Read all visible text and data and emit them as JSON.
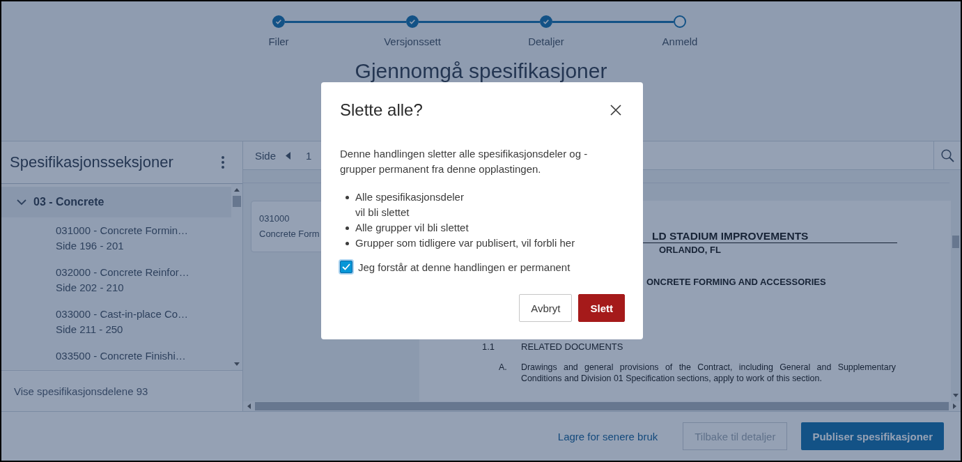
{
  "stepper": [
    {
      "label": "Filer",
      "done": true
    },
    {
      "label": "Versjonssett",
      "done": true
    },
    {
      "label": "Detaljer",
      "done": true
    },
    {
      "label": "Anmeld",
      "done": false
    }
  ],
  "page_title": "Gjennomgå spesifikasjoner",
  "sections_panel": {
    "title": "Spesifikasjonsseksjoner",
    "group": {
      "label": "03 - Concrete",
      "expanded": true,
      "children": [
        {
          "title": "031000 - Concrete Formin…",
          "pages": "Side 196 - 201"
        },
        {
          "title": "032000 - Concrete Reinfor…",
          "pages": "Side 202 - 210"
        },
        {
          "title": "033000 - Cast-in-place Co…",
          "pages": "Side 211 - 250"
        },
        {
          "title": "033500 - Concrete Finishi…"
        }
      ]
    },
    "footer": "Vise spesifikasjonsdelene 93"
  },
  "viewer": {
    "page_label": "Side",
    "page_number": "1",
    "card": {
      "code": "031000",
      "title": "Concrete Form"
    },
    "document": {
      "heading": "LD STADIUM IMPROVEMENTS",
      "location": "ORLANDO, FL",
      "section": "ONCRETE FORMING AND ACCESSORIES",
      "article_number": "1.1",
      "article": "RELATED DOCUMENTS",
      "item_label": "A.",
      "item_text": "Drawings and general provisions of the Contract, including General and Supplementary Conditions and Division 01 Specification sections, apply to work of this section."
    }
  },
  "footer_actions": {
    "save_link": "Lagre for senere bruk",
    "back_button": {
      "label": "Tilbake til detaljer",
      "disabled": true
    },
    "publish_button": "Publiser spesifikasjoner"
  },
  "dialog": {
    "title": "Slette alle?",
    "message": "Denne handlingen sletter alle spesifikasjonsdeler og - grupper permanent fra denne opplastingen.",
    "bullets": [
      "Alle spesifikasjonsdeler\nvil bli slettet",
      "Alle grupper vil bli slettet",
      "Grupper som tidligere var publisert, vil forbli her"
    ],
    "confirm": {
      "label": "Jeg forstår at denne handlingen er permanent",
      "checked": true
    },
    "buttons": [
      {
        "label": "Avbryt",
        "kind": "secondary"
      },
      {
        "label": "Slett",
        "kind": "danger"
      }
    ]
  }
}
